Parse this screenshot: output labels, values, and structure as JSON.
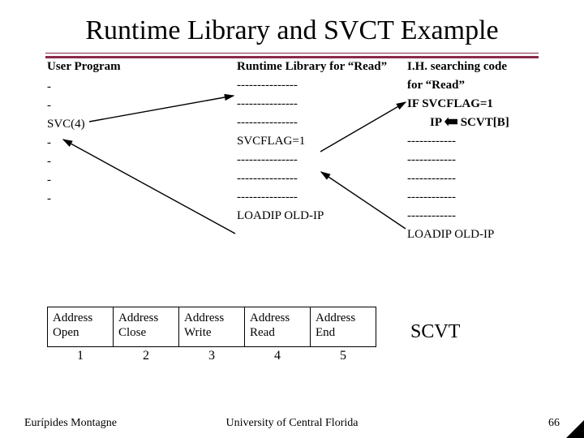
{
  "title": "Runtime Library and SVCT Example",
  "left": {
    "header": "User Program",
    "lines": [
      "-",
      "-",
      "SVC(4)",
      "-",
      "-",
      "-",
      "-"
    ]
  },
  "mid": {
    "header": "Runtime Library for “Read”",
    "lines": [
      "---------------",
      "---------------",
      "---------------",
      "SVCFLAG=1",
      "---------------",
      "---------------",
      "---------------",
      "LOADIP OLD-IP"
    ]
  },
  "right": {
    "header": "I.H. searching code",
    "sub1": "for “Read”",
    "cond": "IF SVCFLAG=1",
    "jump_prefix": "IP ",
    "jump_suffix": " SCVT[B]",
    "lines": [
      "------------",
      "------------",
      "------------",
      "------------",
      "------------",
      "LOADIP OLD-IP"
    ]
  },
  "table": {
    "cells": [
      {
        "l1": "Address",
        "l2": "Open"
      },
      {
        "l1": "Address",
        "l2": "Close"
      },
      {
        "l1": "Address",
        "l2": "Write"
      },
      {
        "l1": "Address",
        "l2": "Read"
      },
      {
        "l1": "Address",
        "l2": "End"
      }
    ],
    "nums": [
      "1",
      "2",
      "3",
      "4",
      "5"
    ],
    "label": "SCVT"
  },
  "footer": {
    "author": "Eurípides Montagne",
    "uni": "University of Central Florida",
    "page": "66"
  }
}
